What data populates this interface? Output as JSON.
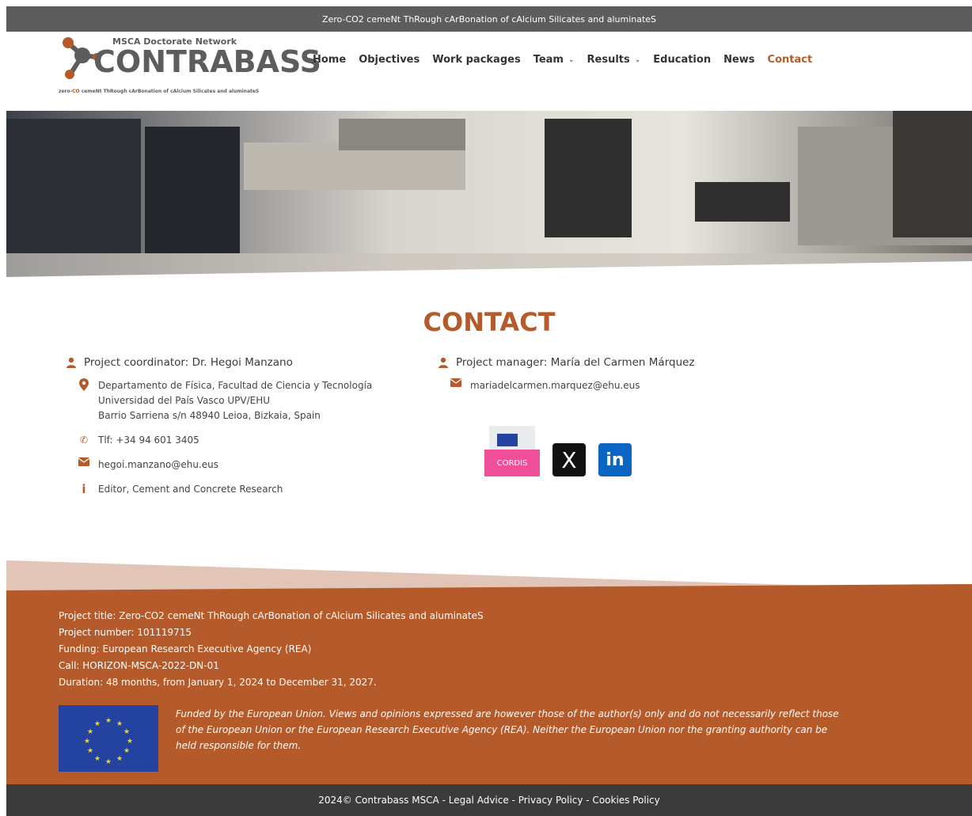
{
  "topbar": {
    "text": "Zero-CO2 cemeNt ThRough cArBonation of cAlcium Silicates and aluminateS"
  },
  "logo": {
    "top": "MSCA Doctorate Network",
    "main": "CONTRABASS",
    "sub_pre": "zero-",
    "sub_co": "CO",
    "sub_mid": " cemeNt ThRough cArBonation of cAlcium Silicates and aluminateS"
  },
  "nav": {
    "home": "Home",
    "objectives": "Objectives",
    "work_packages": "Work packages",
    "team": "Team",
    "results": "Results",
    "education": "Education",
    "news": "News",
    "contact": "Contact"
  },
  "page": {
    "title": "CONTACT"
  },
  "coordinator": {
    "label": "Project coordinator: Dr. Hegoi Manzano",
    "addr1": "Departamento de Física, Facultad de Ciencia y Tecnología",
    "addr2": "Universidad del País Vasco UPV/EHU",
    "addr3": "Barrio Sarriena s/n 48940 Leioa, Bizkaia, Spain",
    "phone": "Tlf: +34 94 601 3405",
    "email": "hegoi.manzano@ehu.eus",
    "note": "Editor, Cement and Concrete Research"
  },
  "manager": {
    "label": "Project manager: María del Carmen Márquez",
    "email": "mariadelcarmen.marquez@ehu.eus"
  },
  "social": {
    "cordis": "CORDIS",
    "x": "X",
    "linkedin": "in"
  },
  "footer": {
    "line1": "Project title: Zero-CO2 cemeNt ThRough cArBonation of cAlcium Silicates and aluminateS",
    "line2": "Project number: 101119715",
    "line3": "Funding: European Research Executive Agency (REA)",
    "line4": "Call: HORIZON-MSCA-2022-DN-01",
    "line5": "Duration: 48 months, from January 1, 2024 to December 31, 2027.",
    "disclaimer": "Funded by the European Union. Views and opinions expressed are however those of the author(s) only and do not necessarily reflect those of the European Union or the European Research Executive Agency (REA). Neither the European Union nor the granting authority can be held responsible for them."
  },
  "bottombar": {
    "text": "2024© Contrabass MSCA - Legal Advice - Privacy Policy - Cookies Policy"
  },
  "colors": {
    "accent": "#b45a2b",
    "dark": "#5d5d5d",
    "footer_bottom": "#3b3b3b"
  }
}
